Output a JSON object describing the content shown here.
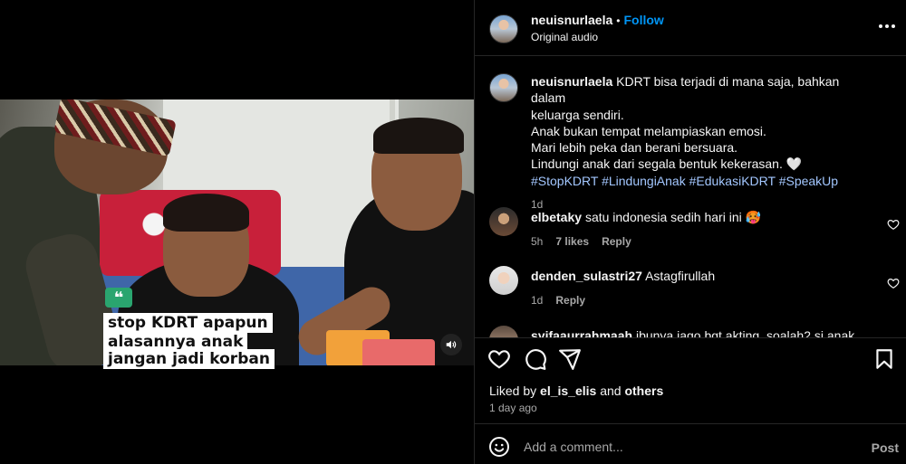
{
  "post": {
    "username": "neuisnurlaela",
    "follow_label": "Follow",
    "audio": "Original audio",
    "caption_lines": [
      "KDRT bisa terjadi di mana saja, bahkan dalam",
      "keluarga sendiri.",
      "Anak bukan tempat melampiaskan emosi.",
      "Mari lebih peka dan berani bersuara.",
      "Lindungi anak dari segala bentuk kekerasan. 🤍"
    ],
    "hashtags": "#StopKDRT #LindungiAnak #EdukasiKDRT #SpeakUp",
    "caption_age": "1d"
  },
  "video": {
    "quote_mark": "❝",
    "caption_lines": [
      "stop KDRT apapun",
      "alasannya anak",
      "jangan jadi korban"
    ]
  },
  "comments": [
    {
      "username": "elbetaky",
      "text": "satu indonesia sedih hari ini 🥵",
      "age": "5h",
      "likes": "7 likes",
      "reply": "Reply"
    },
    {
      "username": "denden_sulastri27",
      "text": "Astagfirullah",
      "age": "1d",
      "likes": "",
      "reply": "Reply"
    },
    {
      "username": "syifaaurrahmaah",
      "text": "ibunya jago bgt akting, soalah2 si anak",
      "age": "",
      "likes": "",
      "reply": ""
    }
  ],
  "engagement": {
    "liked_by_prefix": "Liked by ",
    "liked_by_user": "el_is_elis",
    "liked_by_suffix": " and ",
    "liked_by_others": "others",
    "posted_ago": "1 day ago"
  },
  "add_comment": {
    "placeholder": "Add a comment...",
    "post_label": "Post"
  },
  "colors": {
    "background": "#000000",
    "text": "#f5f5f5",
    "muted": "#a8a8a8",
    "link_blue": "#0095f6",
    "hashtag": "#a3c7ff"
  }
}
